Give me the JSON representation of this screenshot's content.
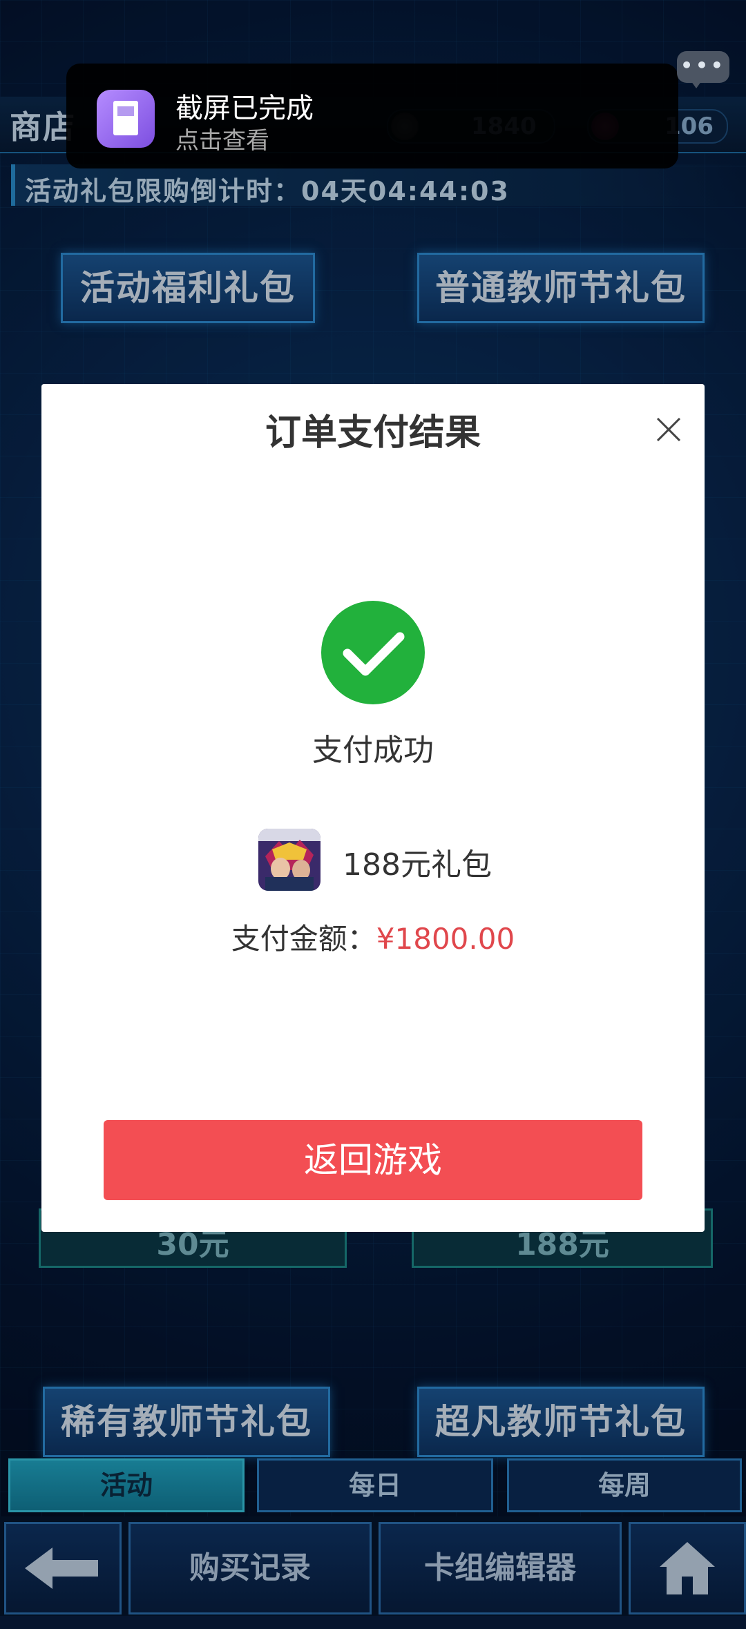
{
  "notification": {
    "title": "截屏已完成",
    "subtitle": "点击查看"
  },
  "header": {
    "title": "商店",
    "currency": [
      {
        "icon": "coin-icon",
        "value": "1840"
      },
      {
        "icon": "gem-icon",
        "value": "106"
      }
    ],
    "countdown": "活动礼包限购倒计时：04天04:44:03"
  },
  "background_buttons": {
    "top_left": "活动福利礼包",
    "top_right": "普通教师节礼包",
    "price_left": "30元",
    "price_right": "188元",
    "bottom_left": "稀有教师节礼包",
    "bottom_right": "超凡教师节礼包"
  },
  "tabs": [
    {
      "label": "活动",
      "active": true
    },
    {
      "label": "每日",
      "active": false
    },
    {
      "label": "每周",
      "active": false
    }
  ],
  "bottom_bar": {
    "purchase_history": "购买记录",
    "deck_editor": "卡组编辑器"
  },
  "dialog": {
    "title": "订单支付结果",
    "status": "支付成功",
    "item_name": "188元礼包",
    "amount_label": "支付金额：",
    "amount_value": "¥1800.00",
    "return_button": "返回游戏"
  },
  "colors": {
    "success": "#22b13c",
    "amount": "#e0474c",
    "return_button": "#f34e53"
  }
}
